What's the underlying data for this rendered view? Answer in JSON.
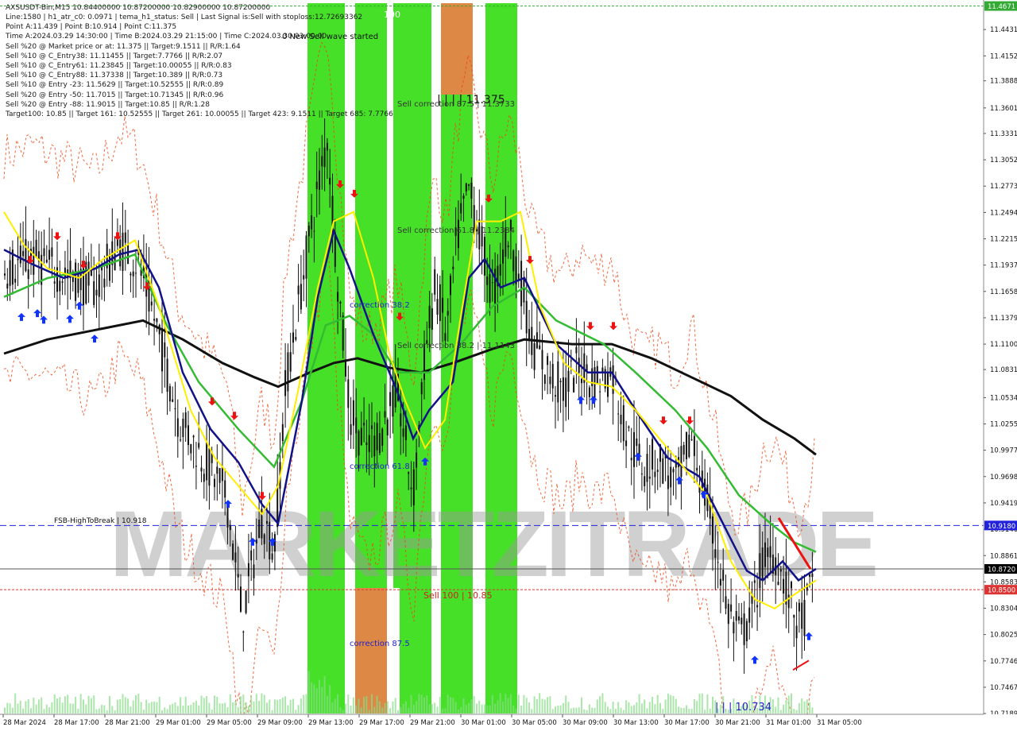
{
  "chart_data": {
    "type": "candlestick",
    "symbol_line": "AXSUSDT-Bin,M15  10.84400000 10.87200000 10.82900000 10.87200000",
    "info_lines": [
      "Line:1580 | h1_atr_c0: 0.0971 | tema_h1_status: Sell | Last Signal is:Sell with stoploss:12.72693362",
      "Point A:11.439 | Point B:10.914 | Point C:11.375",
      "Time A:2024.03.29 14:30:00 | Time B:2024.03.29 21:15:00 | Time C:2024.03.30 03:00:00",
      "Sell %20 @ Market price or at: 11.375 || Target:9.1511 || R/R:1.64",
      "Sell %10 @ C_Entry38: 11.11455 || Target:7.7766 || R/R:2.07",
      "Sell %10 @ C_Entry61: 11.23845 || Target:10.00055 || R/R:0.83",
      "Sell %10 @ C_Entry88: 11.37338 || Target:10.389 || R/R:0.73",
      "Sell %10 @ Entry -23: 11.5629 || Target:10.52555 || R/R:0.89",
      "Sell %20 @ Entry -50: 11.7015 || Target:10.71345 || R/R:0.96",
      "Sell %20 @ Entry -88: 11.9015 || Target:10.85 || R/R:1.28",
      "Target100: 10.85 || Target 161: 10.52555 || Target 261: 10.00055 || Target 423: 9.1511 || Target 685: 7.7766"
    ],
    "y_ticks": [
      "11.4431",
      "11.4152",
      "11.3888",
      "11.3601",
      "11.3331",
      "11.3052",
      "11.2773",
      "11.2494",
      "11.2215",
      "11.1937",
      "11.1658",
      "11.1379",
      "11.1100",
      "11.0831",
      "11.0534",
      "11.0255",
      "10.9977",
      "10.9698",
      "10.9419",
      "10.9140",
      "10.8861",
      "10.8583",
      "10.8304",
      "10.8025",
      "10.7746",
      "10.7467",
      "10.7189"
    ],
    "x_ticks": [
      "28 Mar 2024",
      "28 Mar 17:00",
      "28 Mar 21:00",
      "29 Mar 01:00",
      "29 Mar 05:00",
      "29 Mar 09:00",
      "29 Mar 13:00",
      "29 Mar 17:00",
      "29 Mar 21:00",
      "30 Mar 01:00",
      "30 Mar 05:00",
      "30 Mar 09:00",
      "30 Mar 13:00",
      "30 Mar 17:00",
      "30 Mar 21:00",
      "31 Mar 01:00",
      "31 Mar 05:00"
    ],
    "y_range": [
      10.7189,
      11.471
    ],
    "price_tags": [
      {
        "text": "11.4671",
        "bg": "#33aa33"
      },
      {
        "text": "10.9180",
        "bg": "#2222dd"
      },
      {
        "text": "10.8720",
        "bg": "#000000"
      },
      {
        "text": "10.8500",
        "bg": "#dd3333"
      }
    ],
    "hlines": {
      "fsb": 10.918,
      "current": 10.872,
      "sell100": 10.85,
      "top": 11.468
    },
    "annotations": {
      "hundred": "100",
      "new_sell_wave": "0 New Sell wave started",
      "c_level": "| | | | 11.375",
      "sell_corr_875": "Sell correction 87.5 | 11.3733",
      "sell_corr_618": "Sell correction 61.8 | 11.2384",
      "sell_corr_382": "Sell correction 38.2 | 11.1143",
      "corr_382": "correction 38.2",
      "corr_618": "correction 61.8",
      "corr_875": "correction 87.5",
      "fsb_label": "FSB-HighToBreak | 10.918",
      "sell100_label": "Sell 100 | 10.85",
      "low_label": "| | | 10.734",
      "watermark": "MARKETZITRADE"
    },
    "zones": [
      {
        "x0": 387,
        "x1": 434,
        "color": "green"
      },
      {
        "x0": 447,
        "x1": 487,
        "color": "green"
      },
      {
        "x0": 495,
        "x1": 503,
        "color": "green"
      },
      {
        "x0": 503,
        "x1": 543,
        "color": "green"
      },
      {
        "x0": 555,
        "x1": 595,
        "color": "green"
      },
      {
        "x0": 611,
        "x1": 651,
        "color": "green"
      }
    ],
    "colors": {
      "green_zone": "#33dd11",
      "orange_zone": "#dd8844",
      "ema_black": "#111111",
      "ema_green": "#33bb33",
      "ema_navy": "#111188",
      "ema_yellow": "#ffee00",
      "band_red": "#ee4411",
      "buy_arrow": "#1133ff",
      "sell_arrow": "#ee1111"
    }
  }
}
